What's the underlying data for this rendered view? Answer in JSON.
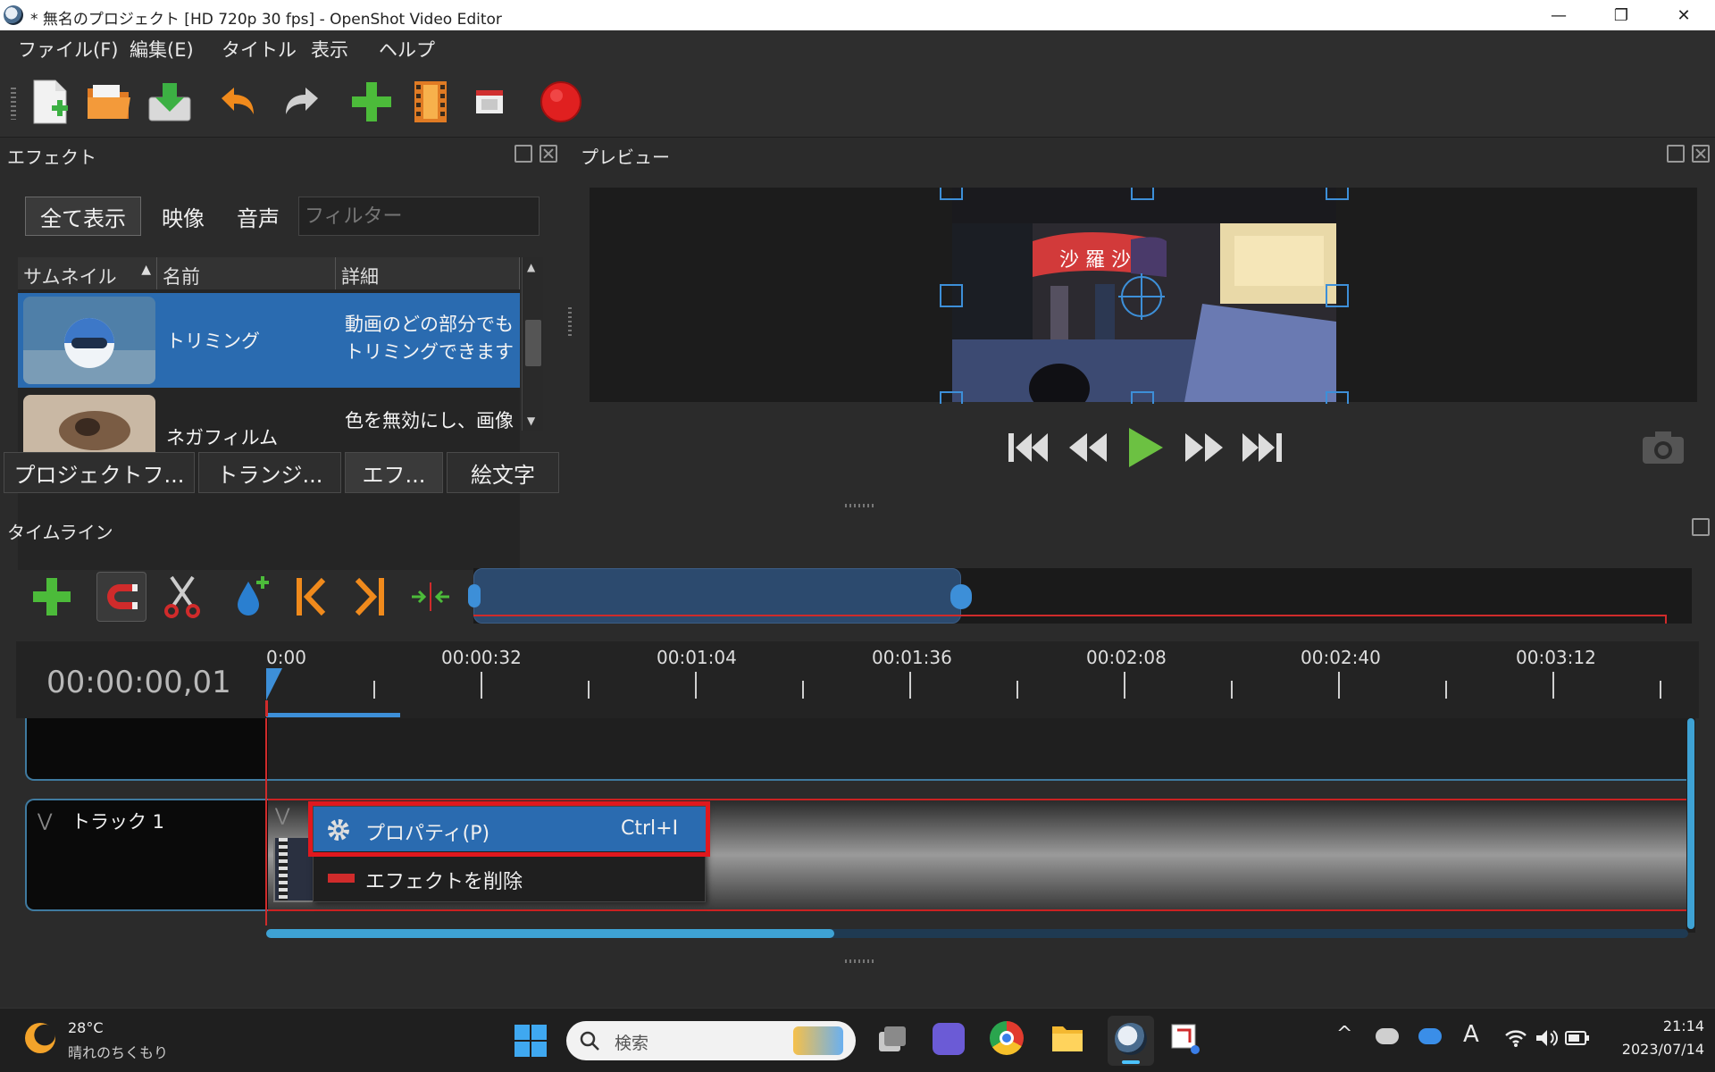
{
  "window": {
    "title": "* 無名のプロジェクト [HD 720p 30 fps] - OpenShot Video Editor",
    "minimize": "—",
    "restore": "❐",
    "close": "✕"
  },
  "menu": [
    "ファイル(F)",
    "編集(E)",
    "タイトル",
    "表示",
    "ヘルプ"
  ],
  "effects_panel": {
    "title": "エフェクト",
    "filters": [
      "全て表示",
      "映像",
      "音声"
    ],
    "filter_placeholder": "フィルター",
    "columns": [
      "サムネイル",
      "名前",
      "詳細"
    ],
    "rows": [
      {
        "name": "トリミング",
        "desc": "動画のどの部分でもトリミングできます",
        "selected": true
      },
      {
        "name": "ネガフィルム",
        "desc": "色を無効にし、画像",
        "selected": false
      }
    ],
    "tabs": [
      "プロジェクトフ...",
      "トランジ...",
      "エフ...",
      "絵文字"
    ]
  },
  "preview_panel": {
    "title": "プレビュー"
  },
  "timeline": {
    "title": "タイムライン",
    "current_time": "00:00:00,01",
    "ruler_labels": [
      "0:00",
      "00:00:32",
      "00:01:04",
      "00:01:36",
      "00:02:08",
      "00:02:40",
      "00:03:12"
    ],
    "track_name": "トラック 1"
  },
  "context_menu": {
    "items": [
      {
        "label": "プロパティ(P)",
        "shortcut": "Ctrl+I",
        "icon": "gear-icon"
      },
      {
        "label": "エフェクトを削除",
        "shortcut": "",
        "icon": "remove-icon"
      }
    ]
  },
  "taskbar": {
    "weather_temp": "28°C",
    "weather_desc": "晴れのちくもり",
    "search_placeholder": "検索",
    "tray_ime": "A",
    "clock_time": "21:14",
    "clock_date": "2023/07/14"
  }
}
